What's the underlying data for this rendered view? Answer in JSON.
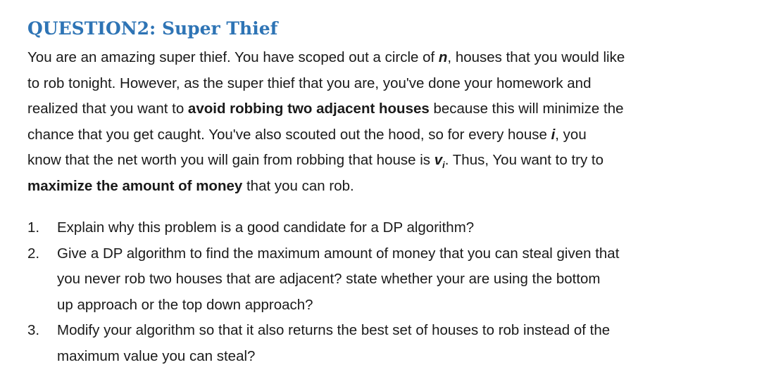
{
  "heading": "QUESTION2: Super Thief",
  "intro": {
    "l1_a": "You are an amazing super thief. You have scoped out a circle of ",
    "l1_n": "n",
    "l1_b": ", houses that you would like",
    "l2": "to rob tonight. However, as the super thief that you are, you've done your homework and",
    "l3_a": "realized that you want to ",
    "l3_bold": "avoid robbing two adjacent houses",
    "l3_b": " because this will minimize the",
    "l4_a": "chance that you get caught. You've also scouted out the hood, so for every house ",
    "l4_i": "i",
    "l4_b": ", you",
    "l5_a": "know that the net worth you will gain from robbing that house is ",
    "l5_v": "v",
    "l5_sub": "i",
    "l5_b": ". Thus, You want to try to",
    "l6_bold": "maximize the amount of money",
    "l6_b": " that you can rob."
  },
  "questions": [
    {
      "number": "1.",
      "lines": [
        "Explain why this problem is a good candidate for a DP algorithm?"
      ]
    },
    {
      "number": "2.",
      "lines": [
        "Give a DP algorithm to find the maximum amount of money that you can steal given that",
        "you never rob two houses that are adjacent? state whether your are using the bottom",
        "up approach or the top down approach?"
      ]
    },
    {
      "number": "3.",
      "lines": [
        "Modify your algorithm so that it also returns the best set of houses to rob instead of the",
        "maximum value you can steal?"
      ]
    }
  ]
}
